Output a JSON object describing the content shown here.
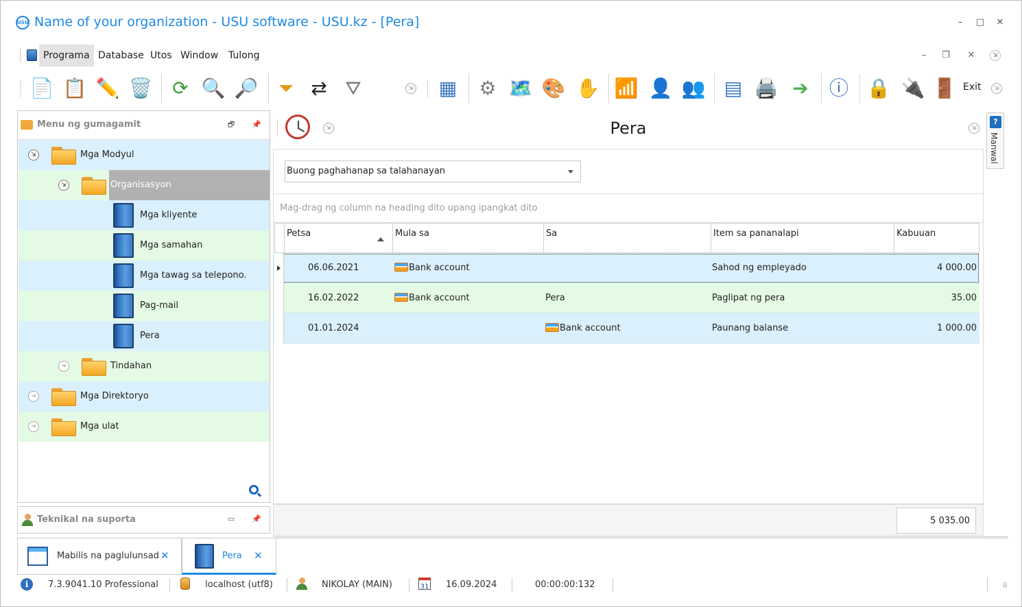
{
  "window": {
    "title": "Name of your organization - USU software - USU.kz - [Pera]",
    "logo_text": "USU"
  },
  "menubar": {
    "items": [
      "Programa",
      "Database",
      "Utos",
      "Window",
      "Tulong"
    ]
  },
  "toolbar": {
    "exit_label": "Exit",
    "icons": [
      "new-document-icon",
      "copy-icon",
      "edit-icon",
      "delete-icon",
      "refresh-icon",
      "search-icon",
      "advanced-search-icon",
      "filter-icon",
      "filter-move-icon",
      "filter-check-icon",
      "grid-view-icon",
      "gear-icon",
      "map-icon",
      "color-wheel-icon",
      "hand-icon",
      "rss-icon",
      "user-key-icon",
      "users-icon",
      "table-icon",
      "printer-icon",
      "forward-icon",
      "info-icon",
      "lock-icon",
      "plug-icon",
      "exit-icon"
    ]
  },
  "left_panel": {
    "title": "Menu ng gumagamit",
    "tree": [
      {
        "label": "Mga Modyul",
        "level": 0,
        "expanded": true
      },
      {
        "label": "Organisasyon",
        "level": 1,
        "expanded": true,
        "selected": true
      },
      {
        "label": "Mga kliyente",
        "level": 2
      },
      {
        "label": "Mga samahan",
        "level": 2
      },
      {
        "label": "Mga tawag sa telepono.",
        "level": 2
      },
      {
        "label": "Pag-mail",
        "level": 2
      },
      {
        "label": "Pera",
        "level": 2
      },
      {
        "label": "Tindahan",
        "level": 1,
        "expanded": false
      },
      {
        "label": "Mga Direktoryo",
        "level": 0,
        "expanded": false
      },
      {
        "label": "Mga ulat",
        "level": 0,
        "expanded": false
      }
    ]
  },
  "tech_panel": {
    "title": "Teknikal na suporta"
  },
  "main": {
    "title": "Pera",
    "period_select": "Buong paghahanap sa talahanayan",
    "group_hint": "Mag-drag ng column na heading dito upang ipangkat dito",
    "columns": [
      "Petsa",
      "Mula sa",
      "Sa",
      "Item sa pananalapi",
      "Kabuuan"
    ],
    "rows": [
      {
        "date": "06.06.2021",
        "from": "Bank account",
        "to": "",
        "item": "Sahod ng empleyado",
        "total": "4 000.00"
      },
      {
        "date": "16.02.2022",
        "from": "Bank account",
        "to": "Pera",
        "item": "Paglipat ng pera",
        "total": "35.00"
      },
      {
        "date": "01.01.2024",
        "from": "",
        "to": "Bank account",
        "item": "Paunang balanse",
        "total": "1 000.00"
      }
    ],
    "grand_total": "5 035.00"
  },
  "side_tab": {
    "label": "Manwal"
  },
  "tabs": [
    {
      "label": "Mabilis na paglulunsad",
      "active": false
    },
    {
      "label": "Pera",
      "active": true
    }
  ],
  "statusbar": {
    "version": "7.3.9041.10 Professional",
    "db": "localhost (utf8)",
    "user": "NIKOLAY (MAIN)",
    "calendar_day": "31",
    "date": "16.09.2024",
    "timer": "00:00:00:132"
  },
  "colors": {
    "accent": "#1e88e5",
    "row_blue": "#daf0fc",
    "row_green": "#e4fae4",
    "selected": "#b1b1b1"
  }
}
